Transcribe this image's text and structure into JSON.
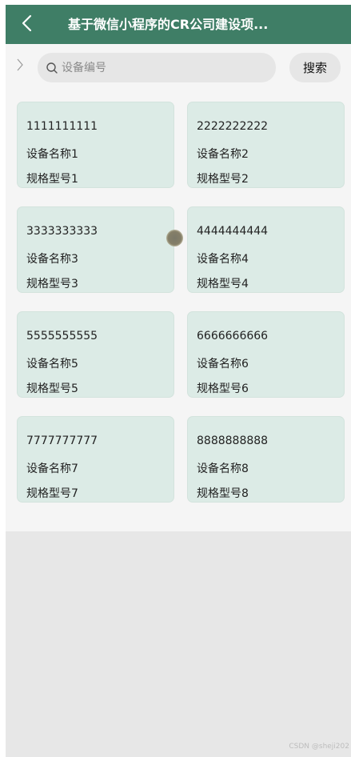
{
  "header": {
    "title": "基于微信小程序的CR公司建设项...",
    "back_icon": "chevron-left-icon"
  },
  "search": {
    "placeholder": "设备编号",
    "value": "",
    "button_label": "搜索",
    "icon": "search-icon",
    "toggle_icon": "chevron-right-icon"
  },
  "devices": [
    {
      "code": "1111111111",
      "name": "设备名称1",
      "model": "规格型号1"
    },
    {
      "code": "2222222222",
      "name": "设备名称2",
      "model": "规格型号2"
    },
    {
      "code": "3333333333",
      "name": "设备名称3",
      "model": "规格型号3"
    },
    {
      "code": "4444444444",
      "name": "设备名称4",
      "model": "规格型号4"
    },
    {
      "code": "5555555555",
      "name": "设备名称5",
      "model": "规格型号5"
    },
    {
      "code": "6666666666",
      "name": "设备名称6",
      "model": "规格型号6"
    },
    {
      "code": "7777777777",
      "name": "设备名称7",
      "model": "规格型号7"
    },
    {
      "code": "8888888888",
      "name": "设备名称8",
      "model": "规格型号8"
    }
  ],
  "watermark": "CSDN @sheji202",
  "colors": {
    "header_bg": "#3f7e66",
    "card_bg": "#dcebe6",
    "page_bg": "#f5f5f5"
  }
}
